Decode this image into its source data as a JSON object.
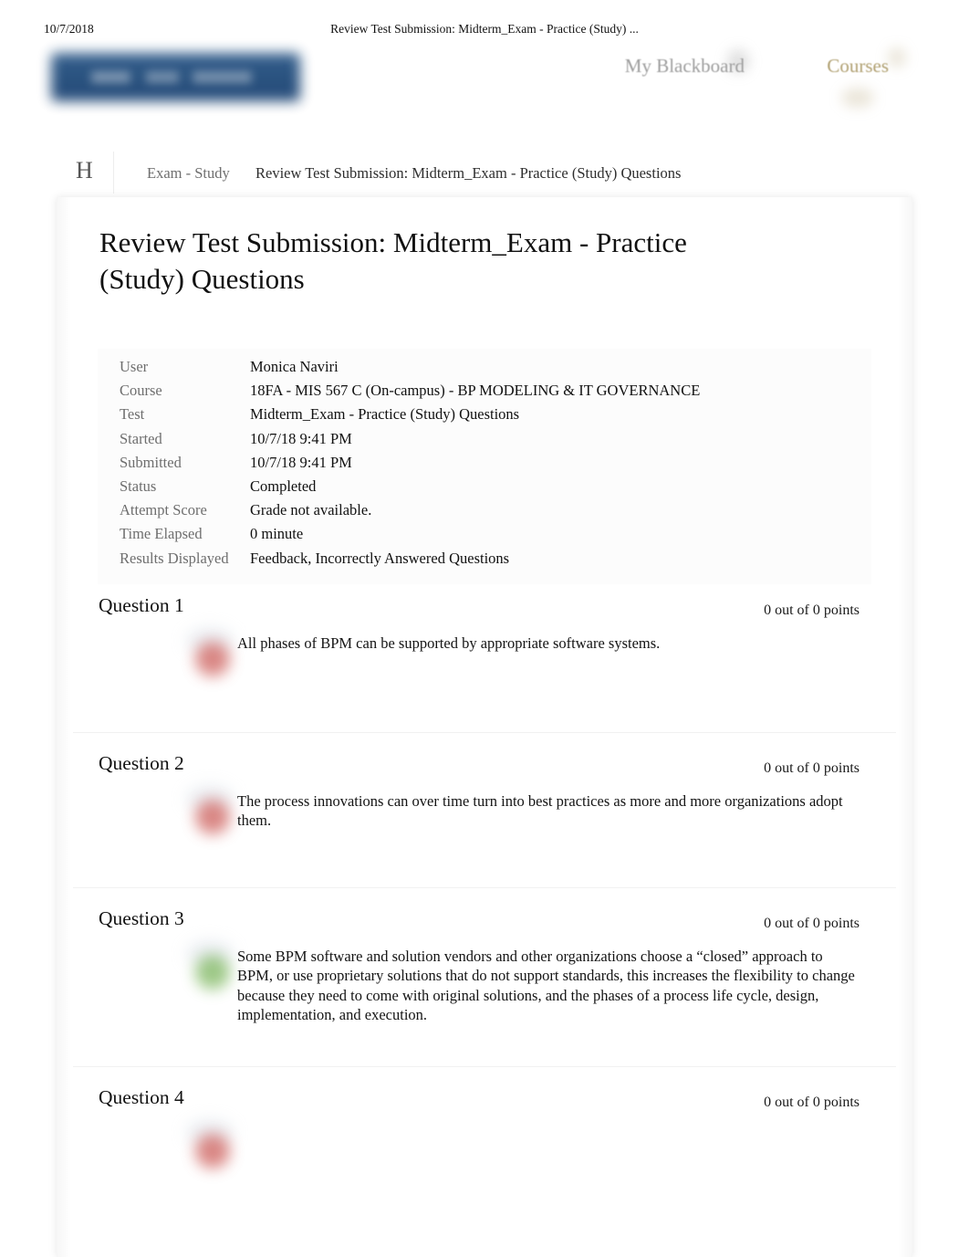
{
  "print_header": {
    "date": "10/7/2018",
    "title": "Review Test Submission: Midterm_Exam - Practice (Study) ..."
  },
  "site_header": {
    "logo_alt": "university-logo",
    "nav": {
      "my_blackboard": "My Blackboard",
      "courses": "Courses"
    },
    "colors": {
      "logo_blue": "#1f4a7a",
      "nav_gray": "#9d9d9d",
      "nav_gold": "#b0a071"
    }
  },
  "breadcrumb": {
    "home": "H",
    "items": [
      "Exam - Study",
      "Review Test Submission: Midterm_Exam - Practice (Study) Questions"
    ]
  },
  "main": {
    "page_title": "Review Test Submission: Midterm_Exam - Practice (Study) Questions",
    "info_table": {
      "rows": [
        {
          "label": "User",
          "value": "Monica Naviri"
        },
        {
          "label": "Course",
          "value": "18FA - MIS 567 C (On-campus) - BP MODELING & IT GOVERNANCE"
        },
        {
          "label": "Test",
          "value": "Midterm_Exam - Practice (Study) Questions"
        },
        {
          "label": "Started",
          "value": "10/7/18 9:41 PM"
        },
        {
          "label": "Submitted",
          "value": "10/7/18 9:41 PM"
        },
        {
          "label": "Status",
          "value": "Completed"
        },
        {
          "label": "Attempt Score",
          "value": "Grade not available."
        },
        {
          "label": "Time Elapsed",
          "value": "0 minute"
        },
        {
          "label": "Results Displayed",
          "value": "Feedback, Incorrectly Answered Questions"
        }
      ]
    },
    "questions": [
      {
        "label": "Question 1",
        "points": "0 out of 0 points",
        "result_icon": "incorrect-answer-icon",
        "result": "incorrect",
        "text": "All phases of BPM can be supported by appropriate software systems."
      },
      {
        "label": "Question 2",
        "points": "0 out of 0 points",
        "result_icon": "incorrect-answer-icon",
        "result": "incorrect",
        "text": "The process innovations can over time turn into best practices as more and more organizations adopt them."
      },
      {
        "label": "Question 3",
        "points": "0 out of 0 points",
        "result_icon": "correct-answer-icon",
        "result": "correct",
        "text": "Some BPM software and solution vendors and other organizations choose a “closed” approach to BPM, or use proprietary solutions that do not support standards, this increases the flexibility to change because they need to come with original solutions, and the phases of a process life cycle, design, implementation, and execution."
      },
      {
        "label": "Question 4",
        "points": "0 out of 0 points",
        "result_icon": "incorrect-answer-icon",
        "result": "incorrect",
        "text": ""
      }
    ],
    "colors": {
      "incorrect": "#cc5a56",
      "correct": "#63a83e"
    }
  }
}
